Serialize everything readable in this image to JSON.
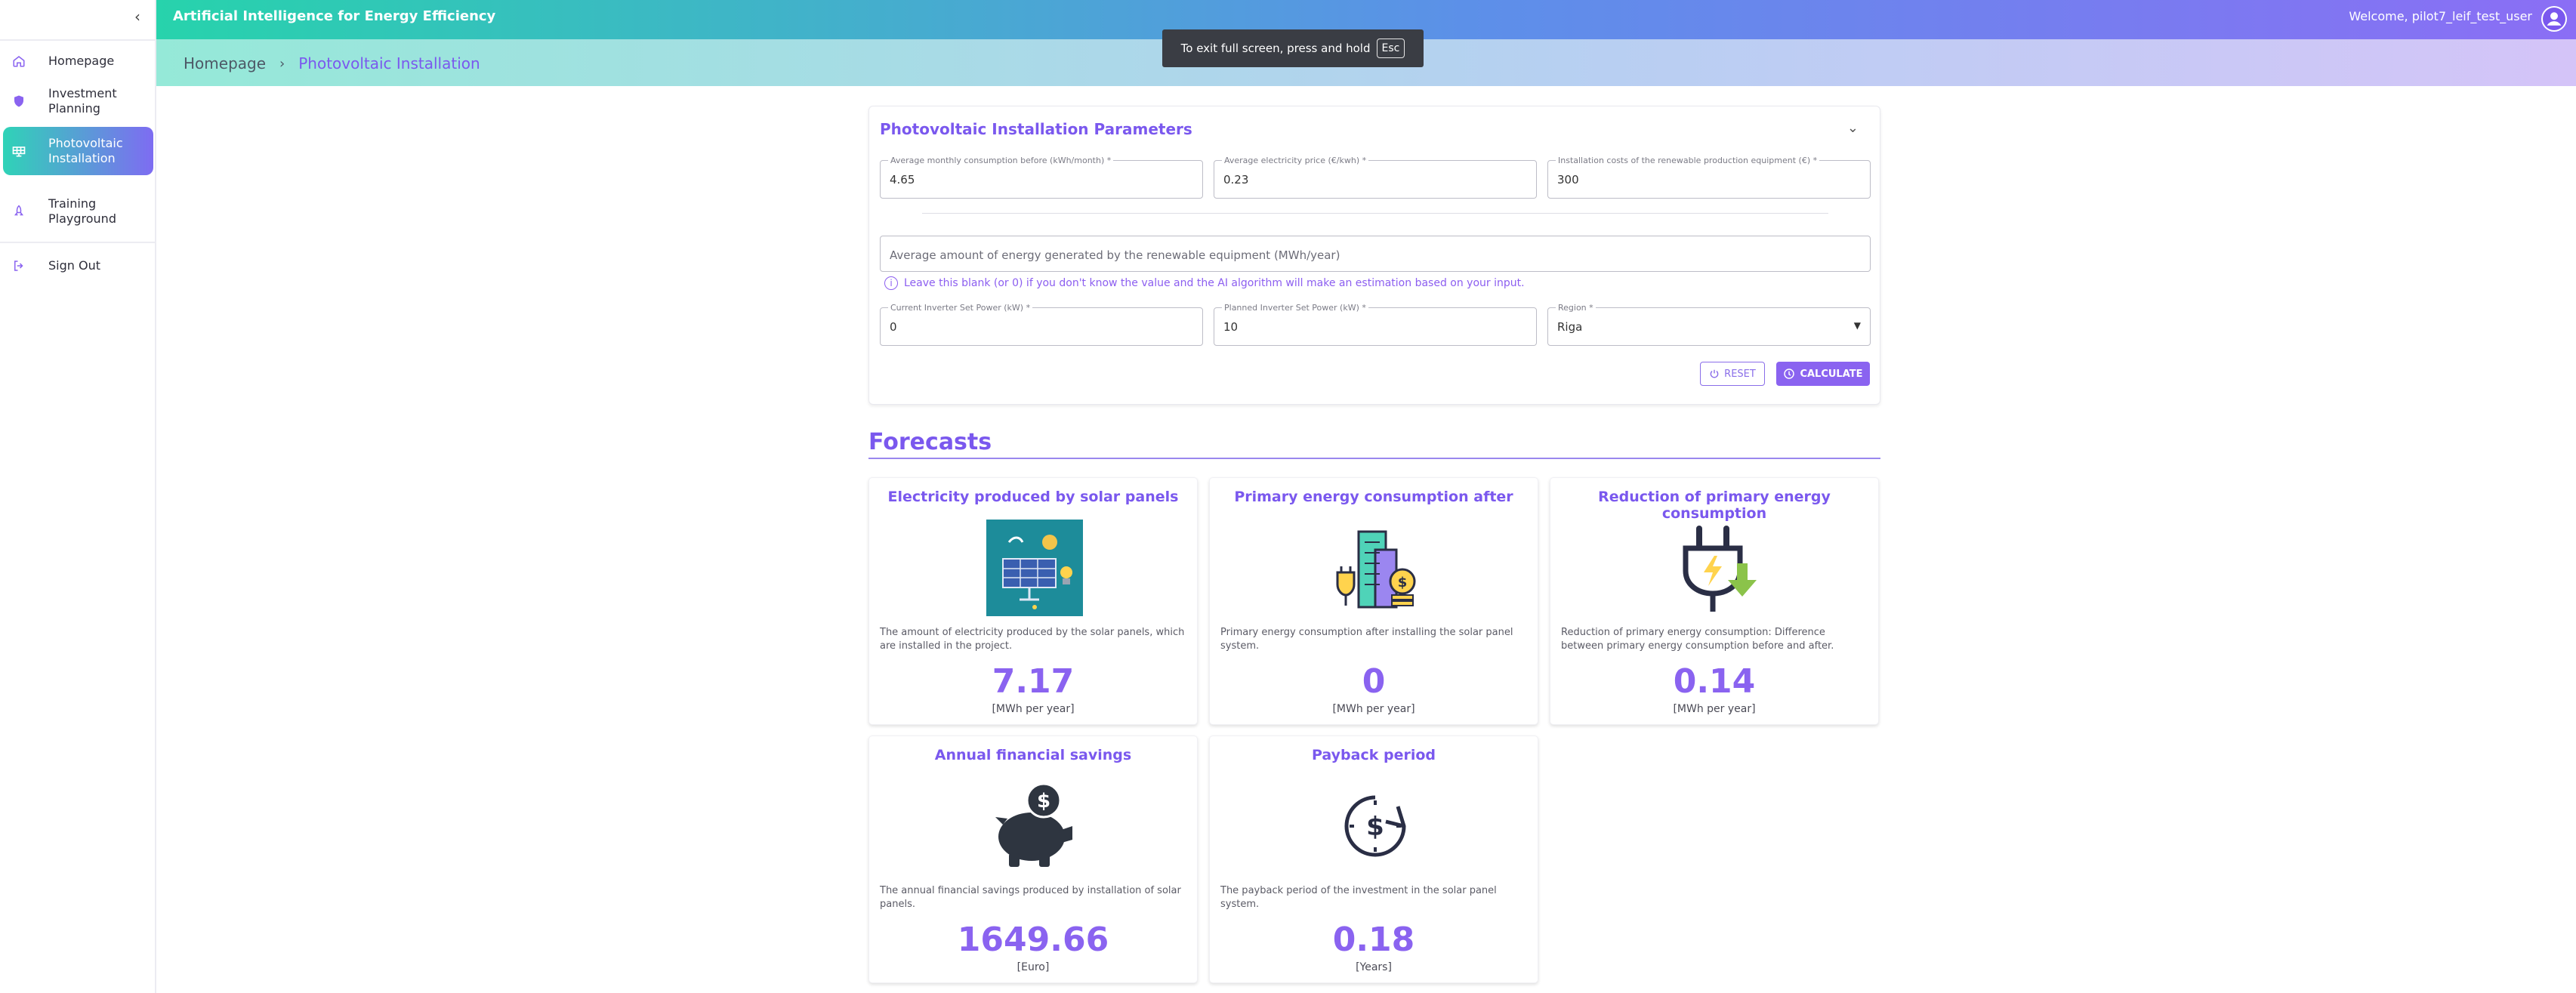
{
  "header": {
    "app_title": "Artificial Intelligence for Energy Efficiency",
    "welcome": "Welcome, pilot7_leif_test_user"
  },
  "fullscreen_toast": {
    "text": "To exit full screen, press and hold",
    "key": "Esc"
  },
  "breadcrumb": {
    "home": "Homepage",
    "separator": "›",
    "current": "Photovoltaic Installation"
  },
  "sidebar": {
    "items": [
      {
        "label": "Homepage",
        "icon": "home-icon",
        "active": false
      },
      {
        "label": "Investment\nPlanning",
        "icon": "shield-icon",
        "active": false
      },
      {
        "label": "Photovoltaic\nInstallation",
        "icon": "solar-panel-icon",
        "active": true
      },
      {
        "label": "Training\nPlayground",
        "icon": "rocket-icon",
        "active": false
      },
      {
        "label": "Sign Out",
        "icon": "sign-out-icon",
        "active": false
      }
    ]
  },
  "params": {
    "title": "Photovoltaic Installation Parameters",
    "monthly_consumption": {
      "label": "Average monthly consumption before (kWh/month) *",
      "value": "4.65"
    },
    "electricity_price": {
      "label": "Average electricity price (€/kwh) *",
      "value": "0.23"
    },
    "installation_costs": {
      "label": "Installation costs of the renewable production equipment (€) *",
      "value": "300"
    },
    "energy_generated": {
      "placeholder": "Average amount of energy generated by the renewable equipment (MWh/year)",
      "value": ""
    },
    "hint": "Leave this blank (or 0) if you don't know the value and the AI algorithm will make an estimation based on your input.",
    "current_inverter": {
      "label": "Current Inverter Set Power (kW) *",
      "value": "0"
    },
    "planned_inverter": {
      "label": "Planned Inverter Set Power (kW) *",
      "value": "10"
    },
    "region": {
      "label": "Region *",
      "value": "Riga"
    },
    "reset_label": "RESET",
    "calculate_label": "CALCULATE"
  },
  "forecasts": {
    "title": "Forecasts",
    "cards": [
      {
        "title": "Electricity produced by solar panels",
        "icon": "solar-panel-illustration",
        "description": "The amount of electricity produced by the solar panels, which are installed in the project.",
        "value": "7.17",
        "unit": "[MWh per year]"
      },
      {
        "title": "Primary energy consumption after",
        "icon": "city-energy-cost-illustration",
        "description": "Primary energy consumption after installing the solar panel system.",
        "value": "0",
        "unit": "[MWh per year]"
      },
      {
        "title": "Reduction of primary energy consumption",
        "icon": "plug-reduction-illustration",
        "description": "Reduction of primary energy consumption: Difference between primary energy consumption before and after.",
        "value": "0.14",
        "unit": "[MWh per year]"
      },
      {
        "title": "Annual financial savings",
        "icon": "piggy-bank-illustration",
        "description": "The annual financial savings produced by installation of solar panels.",
        "value": "1649.66",
        "unit": "[Euro]"
      },
      {
        "title": "Payback period",
        "icon": "payback-clock-illustration",
        "description": "The payback period of the investment in the solar panel system.",
        "value": "0.18",
        "unit": "[Years]"
      }
    ]
  },
  "colors": {
    "accent": "#7a58ee",
    "header_start": "#27d3ac",
    "header_end": "#8b6ef5"
  }
}
